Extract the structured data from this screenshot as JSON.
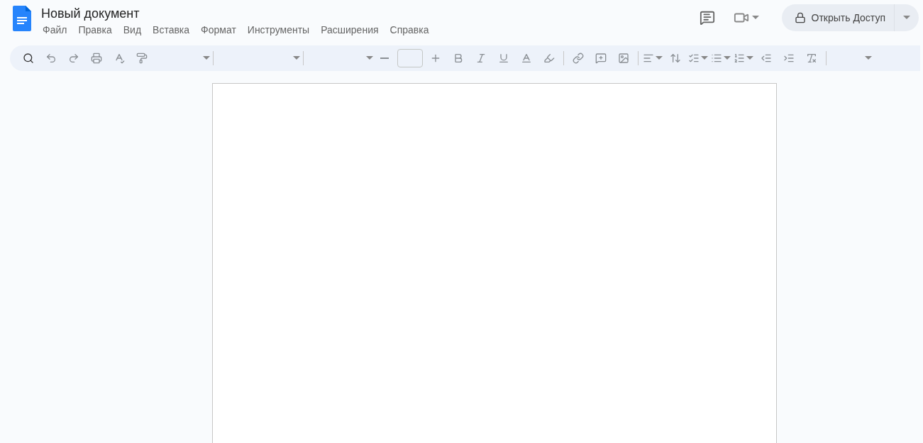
{
  "document": {
    "title": "Новый документ"
  },
  "menu": [
    "Файл",
    "Правка",
    "Вид",
    "Вставка",
    "Формат",
    "Инструменты",
    "Расширения",
    "Справка"
  ],
  "share_button": {
    "label": "Открыть Доступ"
  }
}
